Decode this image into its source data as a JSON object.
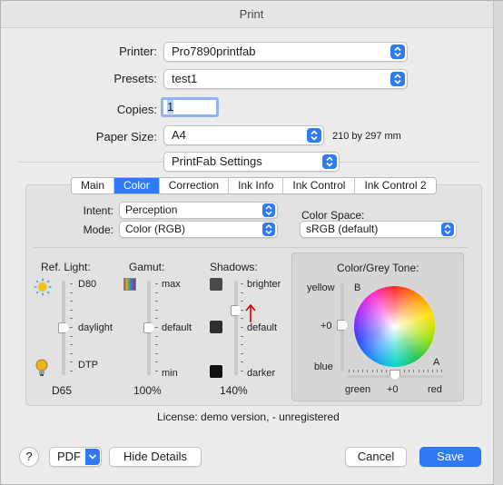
{
  "window": {
    "title": "Print"
  },
  "printer": {
    "label": "Printer:",
    "value": "Pro7890printfab"
  },
  "presets": {
    "label": "Presets:",
    "value": "test1"
  },
  "copies": {
    "label": "Copies:",
    "value": "1"
  },
  "paper_size": {
    "label": "Paper Size:",
    "value": "A4",
    "dimensions": "210 by 297 mm"
  },
  "section_menu": {
    "value": "PrintFab Settings"
  },
  "tabs": [
    {
      "label": "Main"
    },
    {
      "label": "Color",
      "active": true
    },
    {
      "label": "Correction"
    },
    {
      "label": "Ink Info"
    },
    {
      "label": "Ink Control"
    },
    {
      "label": "Ink Control 2"
    }
  ],
  "intent": {
    "label": "Intent:",
    "value": "Perception"
  },
  "mode": {
    "label": "Mode:",
    "value": "Color (RGB)"
  },
  "color_space": {
    "label": "Color Space:",
    "value": "sRGB (default)"
  },
  "ref_light": {
    "label": "Ref. Light:",
    "top": "D80",
    "middle": "daylight",
    "bottom": "DTP",
    "value": "D65",
    "level": 0.5
  },
  "gamut": {
    "label": "Gamut:",
    "top": "max",
    "middle": "default",
    "bottom": "min",
    "value": "100%",
    "level": 0.5
  },
  "shadows": {
    "label": "Shadows:",
    "top": "brighter",
    "middle": "default",
    "bottom": "darker",
    "value": "140%",
    "level": 0.68
  },
  "color_tone": {
    "label": "Color/Grey Tone:",
    "yellow": "yellow",
    "blue": "blue",
    "zero": "+0",
    "green": "green",
    "red": "red",
    "h_zero": "+0",
    "b": "B",
    "a": "A"
  },
  "license": {
    "text": "License: demo version,  - unregistered"
  },
  "footer": {
    "help": "?",
    "pdf": "PDF",
    "hide_details": "Hide Details",
    "cancel": "Cancel",
    "save": "Save"
  },
  "colors": {
    "accent": "#2f7bf5",
    "annotation": "#d40000"
  }
}
